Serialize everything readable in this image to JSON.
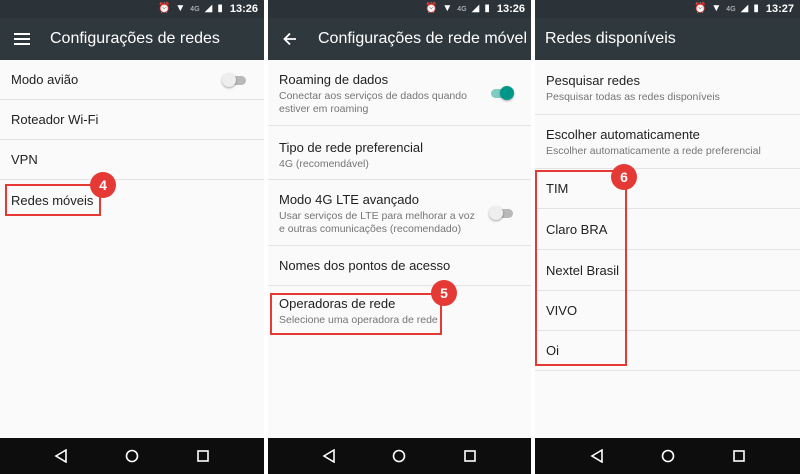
{
  "panels": [
    {
      "status": {
        "time": "13:26",
        "network": "4G"
      },
      "appbar": {
        "title": "Configurações de redes",
        "nav_icon": "menu-icon"
      },
      "items": [
        {
          "primary": "Modo avião",
          "toggle": false
        },
        {
          "primary": "Roteador Wi-Fi"
        },
        {
          "primary": "VPN"
        },
        {
          "primary": "Redes móveis"
        }
      ],
      "step": "4"
    },
    {
      "status": {
        "time": "13:26",
        "network": "4G"
      },
      "appbar": {
        "title": "Configurações de rede móvel",
        "nav_icon": "back-arrow-icon"
      },
      "items": [
        {
          "primary": "Roaming de dados",
          "secondary": "Conectar aos serviços de dados quando estiver em roaming",
          "toggle": true
        },
        {
          "primary": "Tipo de rede preferencial",
          "secondary": "4G (recomendável)"
        },
        {
          "primary": "Modo 4G LTE avançado",
          "secondary": "Usar serviços de LTE para melhorar a voz e outras comunicações (recomendado)",
          "toggle": false
        },
        {
          "primary": "Nomes dos pontos de acesso"
        },
        {
          "primary": "Operadoras de rede",
          "secondary": "Selecione uma operadora de rede"
        }
      ],
      "step": "5"
    },
    {
      "status": {
        "time": "13:27",
        "network": "4G"
      },
      "appbar": {
        "title": "Redes disponíveis"
      },
      "items": [
        {
          "primary": "Pesquisar redes",
          "secondary": "Pesquisar todas as redes disponíveis"
        },
        {
          "primary": "Escolher automaticamente",
          "secondary": "Escolher automaticamente a rede preferencial"
        },
        {
          "primary": "TIM"
        },
        {
          "primary": "Claro BRA"
        },
        {
          "primary": "Nextel Brasil"
        },
        {
          "primary": "VIVO"
        },
        {
          "primary": "Oi"
        }
      ],
      "step": "6"
    }
  ],
  "colors": {
    "status_bar": "#2b3338",
    "app_bar": "#2f383d",
    "accent": "#009688",
    "highlight": "#e53935",
    "nav_bar": "#0d0d0d"
  }
}
